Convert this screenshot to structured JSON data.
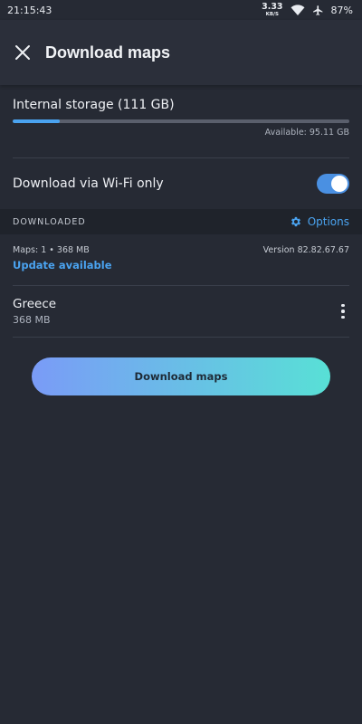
{
  "status_bar": {
    "time": "21:15:43",
    "speed_value": "3.33",
    "speed_unit": "KB/S",
    "battery": "87%",
    "icons": [
      "wifi-icon",
      "airplane-icon"
    ]
  },
  "header": {
    "close_icon": "close-icon",
    "title": "Download maps"
  },
  "storage": {
    "label": "Internal storage (111 GB)",
    "used_fraction": 0.14,
    "available": "Available: 95.11 GB"
  },
  "wifi_only": {
    "label": "Download via Wi-Fi only",
    "enabled": true
  },
  "downloaded_section": {
    "title": "DOWNLOADED",
    "options_label": "Options",
    "options_icon": "gear-icon"
  },
  "maps_info": {
    "summary": "Maps: 1 • 368 MB",
    "version": "Version 82.82.67.67",
    "update_label": "Update available"
  },
  "maps": [
    {
      "name": "Greece",
      "size": "368 MB"
    }
  ],
  "download_button": {
    "label": "Download maps"
  },
  "colors": {
    "background": "#262a34",
    "accent": "#4aa3f0",
    "gradient_start": "#7a9bf7",
    "gradient_end": "#58e0d6"
  }
}
